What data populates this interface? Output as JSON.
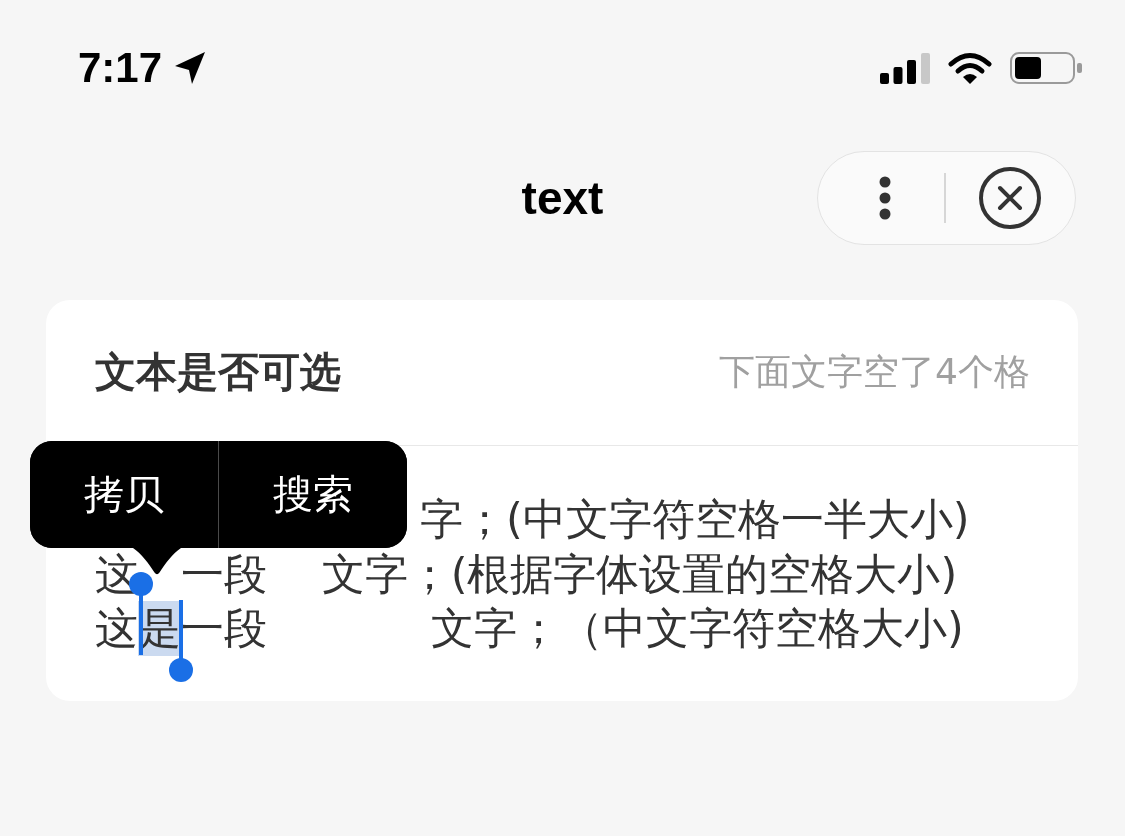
{
  "status_bar": {
    "time": "7:17"
  },
  "nav_bar": {
    "title": "text"
  },
  "card": {
    "title": "文本是否可选",
    "note": "下面文字空了4个格",
    "lines": [
      {
        "covered": true,
        "segments": [
          {
            "text": "字；(中文字符空格一半大小)",
            "selected": false
          }
        ]
      },
      {
        "covered": true,
        "segments": [
          {
            "text": "这",
            "selected": false
          },
          {
            "text": "一段    文字；(根据字体设置的空格大小)",
            "selected": false
          }
        ]
      },
      {
        "covered": false,
        "segments": [
          {
            "text": "这",
            "selected": false
          },
          {
            "text": "是",
            "selected": true
          },
          {
            "text": "一段            文字；（中文字符空格大小)",
            "selected": false
          }
        ]
      }
    ]
  },
  "context_menu": {
    "items": [
      "拷贝",
      "搜索"
    ]
  }
}
